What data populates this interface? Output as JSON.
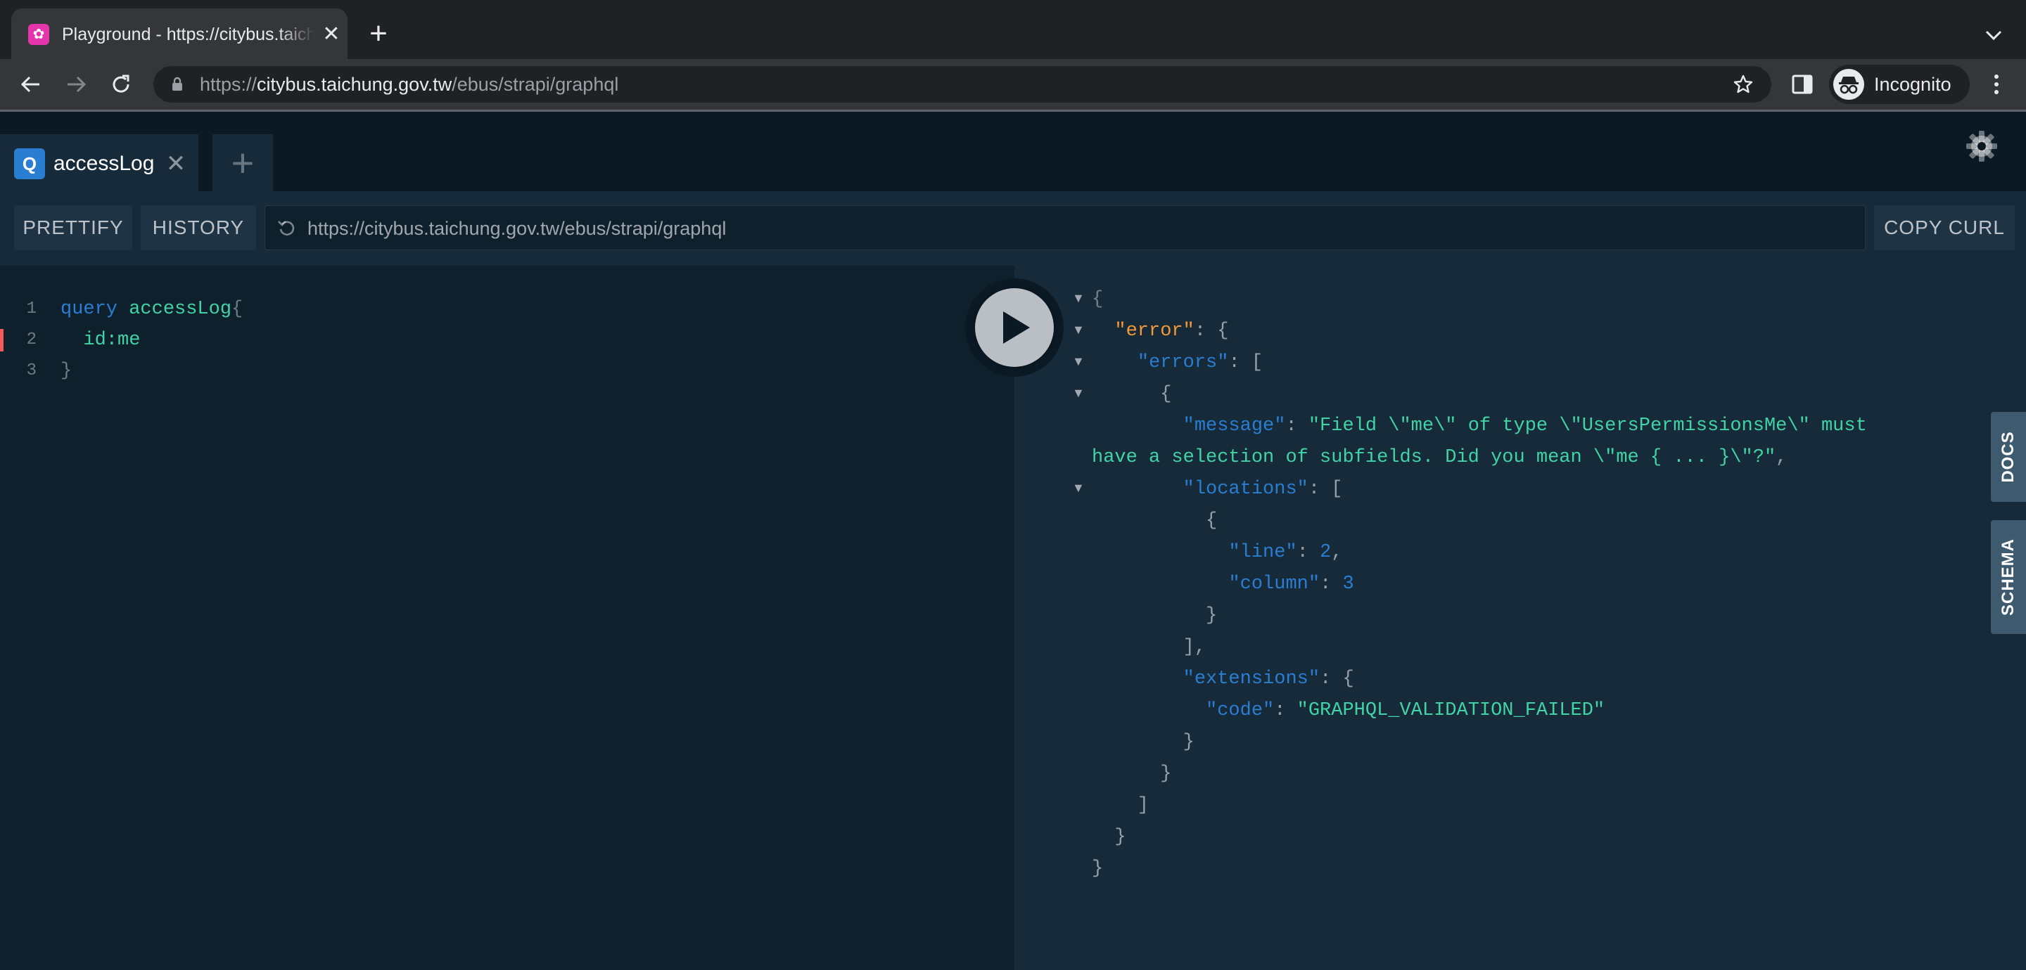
{
  "browser": {
    "tab_title": "Playground - https://citybus.taichung.gov.tw/ebus/strapi/graphql",
    "url_scheme": "https://",
    "url_host": "citybus.taichung.gov.tw",
    "url_path": "/ebus/strapi/graphql",
    "profile_label": "Incognito",
    "tab_close": "✕",
    "new_tab": "+"
  },
  "playground": {
    "tabs": [
      {
        "badge": "Q",
        "label": "accessLog",
        "close": "✕"
      }
    ],
    "new_tab": "+",
    "buttons": {
      "prettify": "PRETTIFY",
      "history": "HISTORY",
      "copy_curl": "COPY CURL"
    },
    "endpoint": "https://citybus.taichung.gov.tw/ebus/strapi/graphql",
    "editor": {
      "lines": [
        {
          "num": "1",
          "kw": "query",
          "name": "accessLog",
          "punct": "{"
        },
        {
          "num": "2",
          "field": "id:me",
          "error": true
        },
        {
          "num": "3",
          "punct": "}"
        }
      ]
    },
    "side_tabs": {
      "docs": "DOCS",
      "schema": "SCHEMA"
    }
  },
  "result": {
    "lines": [
      "{",
      "  \"error\": {",
      "    \"errors\": [",
      "      {",
      "        \"message\": \"Field \\\"me\\\" of type \\\"UsersPermissionsMe\\\" must",
      "have a selection of subfields. Did you mean \\\"me { ... }\\\"?\",",
      "        \"locations\": [",
      "          {",
      "            \"line\": 2,",
      "            \"column\": 3",
      "          }",
      "        ],",
      "        \"extensions\": {",
      "          \"code\": \"GRAPHQL_VALIDATION_FAILED\"",
      "        }",
      "      }",
      "    ]",
      "  }",
      "}"
    ],
    "tokens": {
      "error_key": "\"error\"",
      "errors_key": "\"errors\"",
      "message_key": "\"message\"",
      "message_value_1": "\"Field \\\"me\\\" of type \\\"UsersPermissionsMe\\\" must",
      "message_value_2": "have a selection of subfields. Did you mean \\\"me { ... }\\\"?\"",
      "locations_key": "\"locations\"",
      "line_key": "\"line\"",
      "line_value": "2",
      "column_key": "\"column\"",
      "column_value": "3",
      "extensions_key": "\"extensions\"",
      "code_key": "\"code\"",
      "code_value": "\"GRAPHQL_VALIDATION_FAILED\""
    }
  },
  "colors": {
    "accent_blue": "#2a7ed2",
    "string_green": "#42d3a5",
    "error_orange": "#f29a37",
    "error_marker": "#f25c54",
    "favicon_pink": "#e535ab"
  }
}
